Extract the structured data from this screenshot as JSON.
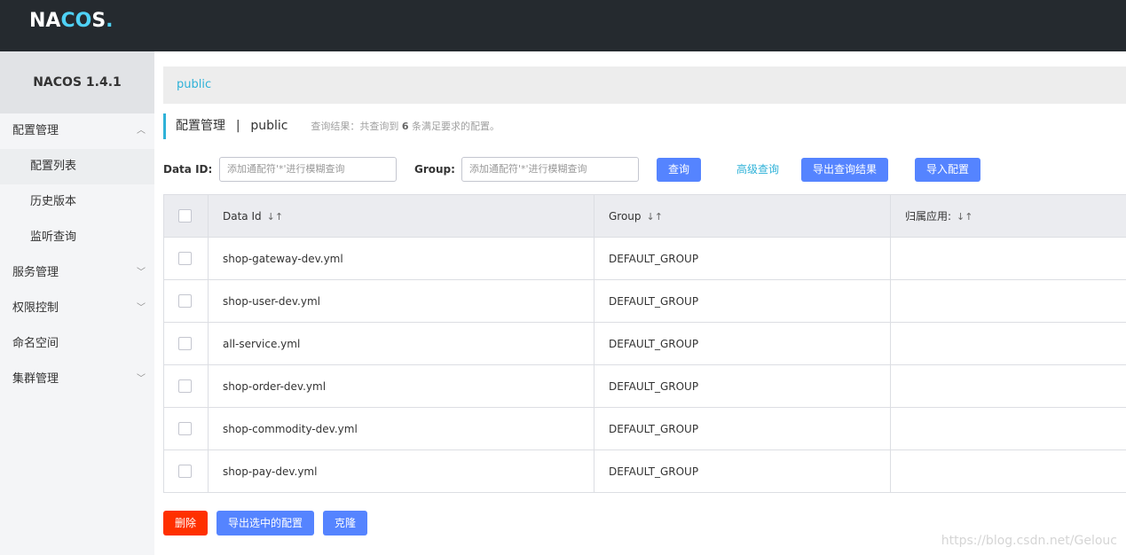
{
  "app": {
    "logo_na": "NA",
    "logo_co": "CO",
    "logo_s": "S",
    "logo_dot": ".",
    "version": "NACOS 1.4.1"
  },
  "sidebar": {
    "items": [
      {
        "label": "配置管理",
        "type": "group",
        "expanded": true
      },
      {
        "label": "配置列表",
        "type": "sub",
        "active": true
      },
      {
        "label": "历史版本",
        "type": "sub"
      },
      {
        "label": "监听查询",
        "type": "sub"
      },
      {
        "label": "服务管理",
        "type": "group"
      },
      {
        "label": "权限控制",
        "type": "group"
      },
      {
        "label": "命名空间",
        "type": "item"
      },
      {
        "label": "集群管理",
        "type": "group"
      }
    ]
  },
  "namespace_bar": {
    "label": "public"
  },
  "header": {
    "title": "配置管理",
    "separator": "|",
    "namespace": "public",
    "hint_prefix": "查询结果：共查询到",
    "hint_count": "6",
    "hint_suffix": "条满足要求的配置。"
  },
  "search": {
    "data_id_label": "Data ID:",
    "data_id_placeholder": "添加通配符'*'进行模糊查询",
    "group_label": "Group:",
    "group_placeholder": "添加通配符'*'进行模糊查询",
    "query_button": "查询",
    "advanced_link": "高级查询",
    "export_results_button": "导出查询结果",
    "import_button": "导入配置"
  },
  "table": {
    "columns": [
      "Data Id",
      "Group",
      "归属应用:"
    ],
    "rows": [
      {
        "data_id": "shop-gateway-dev.yml",
        "group": "DEFAULT_GROUP",
        "app": ""
      },
      {
        "data_id": "shop-user-dev.yml",
        "group": "DEFAULT_GROUP",
        "app": ""
      },
      {
        "data_id": "all-service.yml",
        "group": "DEFAULT_GROUP",
        "app": ""
      },
      {
        "data_id": "shop-order-dev.yml",
        "group": "DEFAULT_GROUP",
        "app": ""
      },
      {
        "data_id": "shop-commodity-dev.yml",
        "group": "DEFAULT_GROUP",
        "app": ""
      },
      {
        "data_id": "shop-pay-dev.yml",
        "group": "DEFAULT_GROUP",
        "app": ""
      }
    ]
  },
  "actions": {
    "delete_button": "删除",
    "export_selected_button": "导出选中的配置",
    "clone_button": "克隆"
  },
  "watermark": "https://blog.csdn.net/Gelouc",
  "colors": {
    "topbar": "#252a2f",
    "accent": "#2fb2d8",
    "primary_button": "#5584ff",
    "danger_button": "#ff3000"
  }
}
